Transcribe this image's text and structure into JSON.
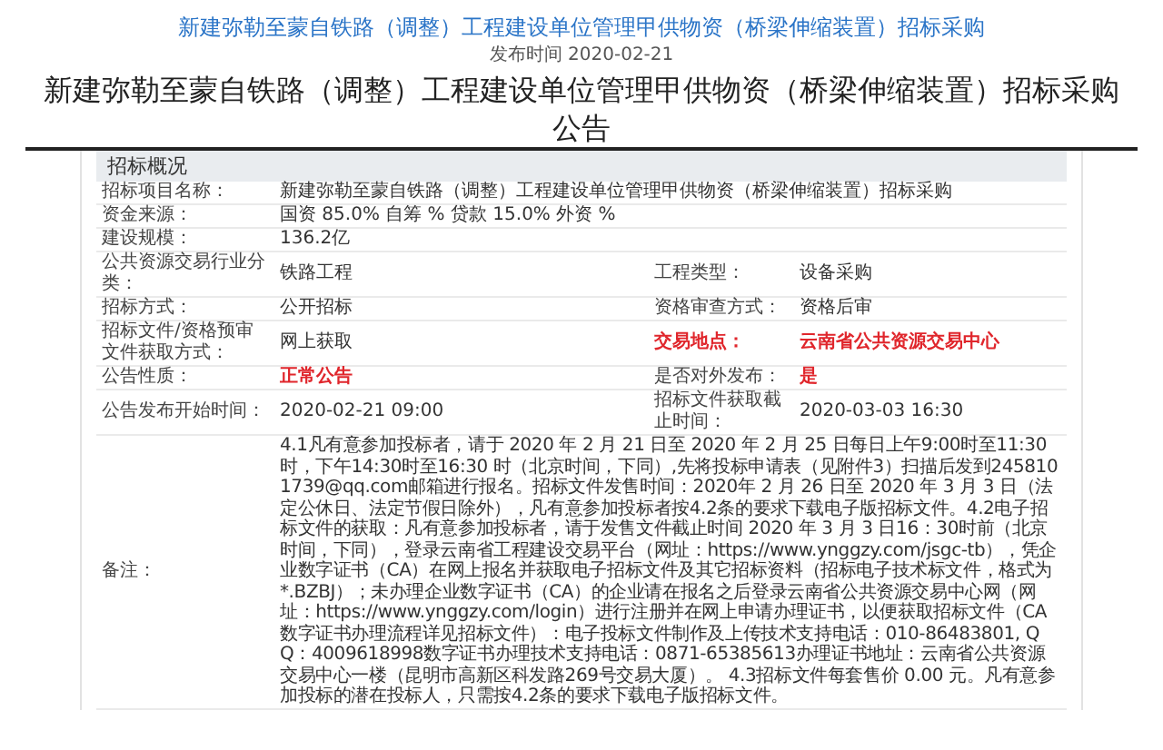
{
  "header": {
    "title": "新建弥勒至蒙自铁路（调整）工程建设单位管理甲供物资（桥梁伸缩装置）招标采购",
    "publish_time": "发布时间 2020-02-21"
  },
  "notice_title": "新建弥勒至蒙自铁路（调整）工程建设单位管理甲供物资（桥梁伸缩装置）招标采购公告",
  "section": {
    "title": "招标概况",
    "rows": [
      [
        {
          "label": "招标项目名称：",
          "value": "新建弥勒至蒙自铁路（调整）工程建设单位管理甲供物资（桥梁伸缩装置）招标采购",
          "label_emphasis": false,
          "value_emphasis": false
        }
      ],
      [
        {
          "label": "资金来源：",
          "value": "国资 85.0% 自筹 % 贷款 15.0% 外资 %",
          "label_emphasis": false,
          "value_emphasis": false
        }
      ],
      [
        {
          "label": "建设规模：",
          "value": "136.2亿",
          "label_emphasis": false,
          "value_emphasis": false
        }
      ],
      [
        {
          "label": "公共资源交易行业分类：",
          "value": "铁路工程",
          "label_emphasis": false,
          "value_emphasis": false
        },
        {
          "label": "工程类型：",
          "value": "设备采购",
          "label_emphasis": false,
          "value_emphasis": false
        }
      ],
      [
        {
          "label": "招标方式：",
          "value": "公开招标",
          "label_emphasis": false,
          "value_emphasis": false
        },
        {
          "label": "资格审查方式：",
          "value": "资格后审",
          "label_emphasis": false,
          "value_emphasis": false
        }
      ],
      [
        {
          "label": "招标文件/资格预审文件获取方式：",
          "value": "网上获取",
          "label_emphasis": false,
          "value_emphasis": false
        },
        {
          "label": "交易地点：",
          "value": "云南省公共资源交易中心",
          "label_emphasis": true,
          "value_emphasis": true
        }
      ],
      [
        {
          "label": "公告性质：",
          "value": "正常公告",
          "label_emphasis": false,
          "value_emphasis": true
        },
        {
          "label": "是否对外发布：",
          "value": "是",
          "label_emphasis": false,
          "value_emphasis": true
        }
      ],
      [
        {
          "label": "公告发布开始时间：",
          "value": "2020-02-21 09:00",
          "label_emphasis": false,
          "value_emphasis": false
        },
        {
          "label": "招标文件获取截止时间：",
          "value": "2020-03-03 16:30",
          "label_emphasis": false,
          "value_emphasis": false
        }
      ],
      [
        {
          "label": "备注：",
          "value": "4.1凡有意参加投标者，请于 2020 年 2 月 21 日至 2020 年 2 月 25 日每日上午9:00时至11:30时，下午14:30时至16:30 时（北京时间，下同）,先将投标申请表（见附件3）扫描后发到2458101739@qq.com邮箱进行报名。招标文件发售时间：2020年 2 月 26 日至 2020 年 3 月 3 日（法定公休日、法定节假日除外），凡有意参加投标者按4.2条的要求下载电子版招标文件。4.2电子招标文件的获取：凡有意参加投标者，请于发售文件截止时间 2020 年 3 月 3 日16：30时前（北京时间，下同），登录云南省工程建设交易平台（网址：https://www.ynggzy.com/jsgc-tb），凭企业数字证书（CA）在网上报名并获取电子招标文件及其它招标资料（招标电子技术标文件，格式为*.BZBJ）；未办理企业数字证书（CA）的企业请在报名之后登录云南省公共资源交易中心网（网址：https://www.ynggzy.com/login）进行注册并在网上申请办理证书，以便获取招标文件（CA数字证书办理流程详见招标文件）：电子投标文件制作及上传技术支持电话：010-86483801, QQ：4009618998数字证书办理技术支持电话：0871-65385613办理证书地址：云南省公共资源交易中心一楼（昆明市高新区科发路269号交易大厦）。 4.3招标文件每套售价 0.00 元。凡有意参加投标的潜在投标人，只需按4.2条的要求下载电子版招标文件。",
          "label_emphasis": false,
          "value_emphasis": false
        }
      ]
    ]
  }
}
